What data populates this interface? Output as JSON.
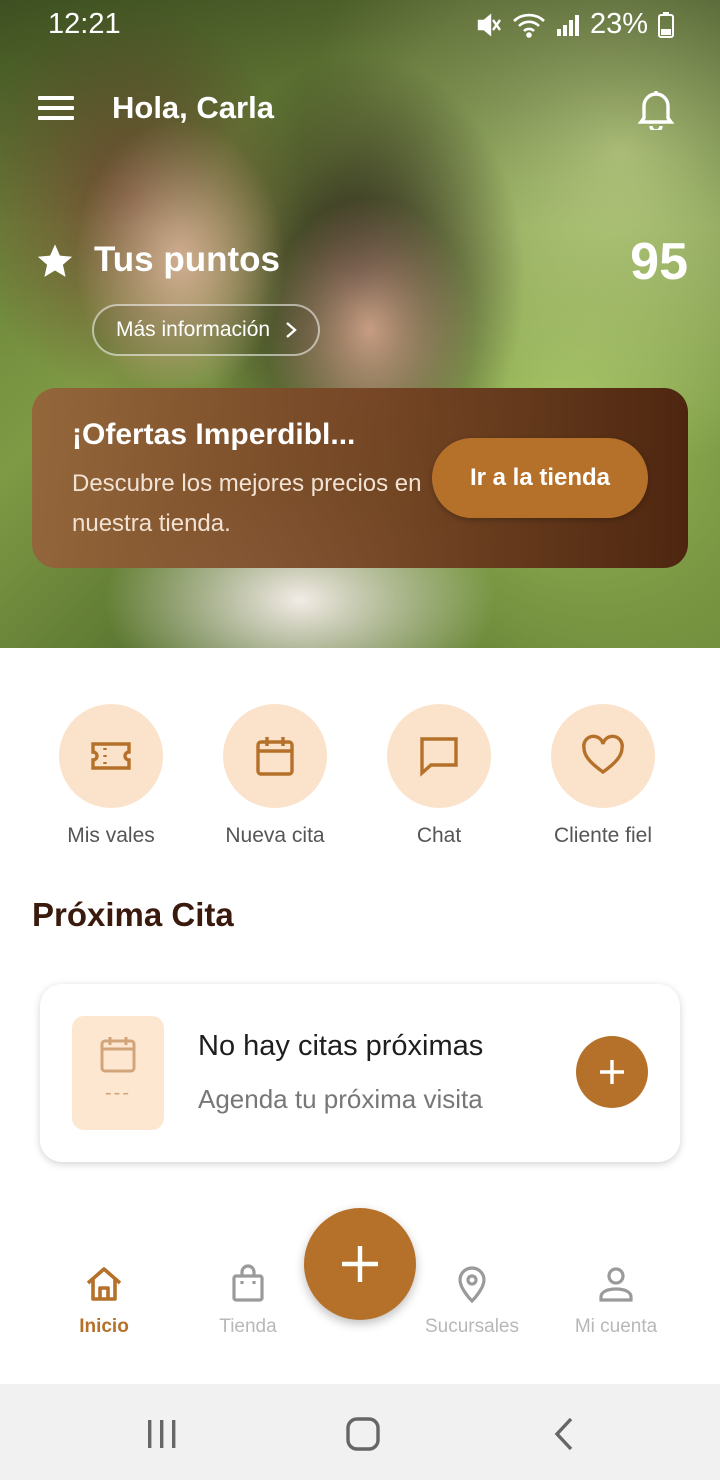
{
  "status_bar": {
    "time": "12:21",
    "battery": "23%"
  },
  "header": {
    "greeting": "Hola, Carla"
  },
  "points": {
    "label": "Tus puntos",
    "value": "95",
    "more_info": "Más información"
  },
  "offer": {
    "title": "¡Ofertas Imperdibl...",
    "description": "Descubre los mejores precios en nuestra tienda.",
    "button": "Ir a la tienda"
  },
  "actions": [
    {
      "label": "Mis vales",
      "icon": "ticket-icon"
    },
    {
      "label": "Nueva cita",
      "icon": "calendar-icon"
    },
    {
      "label": "Chat",
      "icon": "chat-icon"
    },
    {
      "label": "Cliente fiel",
      "icon": "heart-icon"
    }
  ],
  "next_appointment": {
    "section_title": "Próxima Cita",
    "date_placeholder": "---",
    "title": "No hay citas próximas",
    "subtitle": "Agenda tu próxima visita"
  },
  "bottom_nav": [
    {
      "label": "Inicio",
      "icon": "home-icon",
      "active": true
    },
    {
      "label": "Tienda",
      "icon": "shopping-bag-icon",
      "active": false
    },
    {
      "label": "Sucursales",
      "icon": "location-pin-icon",
      "active": false
    },
    {
      "label": "Mi cuenta",
      "icon": "user-icon",
      "active": false
    }
  ],
  "colors": {
    "accent": "#b5712a",
    "action_bg": "#fbe3cb",
    "title": "#3a1a0d"
  }
}
